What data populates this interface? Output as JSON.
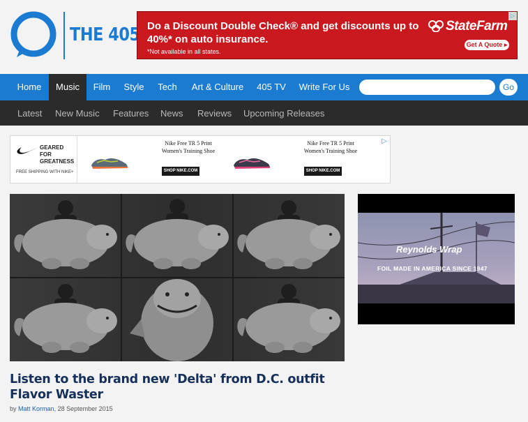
{
  "site": {
    "logo_text": "THE 405",
    "brand_color": "#1a7bd1"
  },
  "top_ad": {
    "headline": "Do a Discount Double Check® and get discounts up to 40%* on auto insurance.",
    "note": "*Not available in all states.",
    "brand": "StateFarm",
    "cta": "Get A Quote ▸",
    "adchoice": "▷",
    "color": "#c9181e"
  },
  "nav": {
    "items": [
      "Home",
      "Music",
      "Film",
      "Style",
      "Tech",
      "Art & Culture",
      "405 TV",
      "Write For Us"
    ],
    "active": "Music",
    "search_placeholder": "",
    "go_label": "Go"
  },
  "subnav": {
    "items": [
      "Latest",
      "New Music",
      "Features",
      "News",
      "Reviews",
      "Upcoming Releases"
    ]
  },
  "banner_ad": {
    "tagline_1": "GEARED FOR",
    "tagline_2": "GREATNESS",
    "free_shipping": "FREE SHIPPING WITH NIKE+",
    "products": [
      {
        "title_1": "Nike Free TR 5 Print",
        "title_2": "Women's Training Shoe",
        "cta": "SHOP NIKE.COM"
      },
      {
        "title_1": "Nike Free TR 5 Print",
        "title_2": "Women's Training Shoe",
        "cta": "SHOP NIKE.COM"
      }
    ],
    "adchoice": "▷"
  },
  "side_ad": {
    "brand": "Reynolds Wrap",
    "tagline": "FOIL MADE IN AMERICA SINCE 1947"
  },
  "article": {
    "title": "Listen to the brand new 'Delta' from D.C. outfit Flavor Waster",
    "by_prefix": "by",
    "author": "Matt Korman",
    "date": ", 28 September 2015"
  }
}
